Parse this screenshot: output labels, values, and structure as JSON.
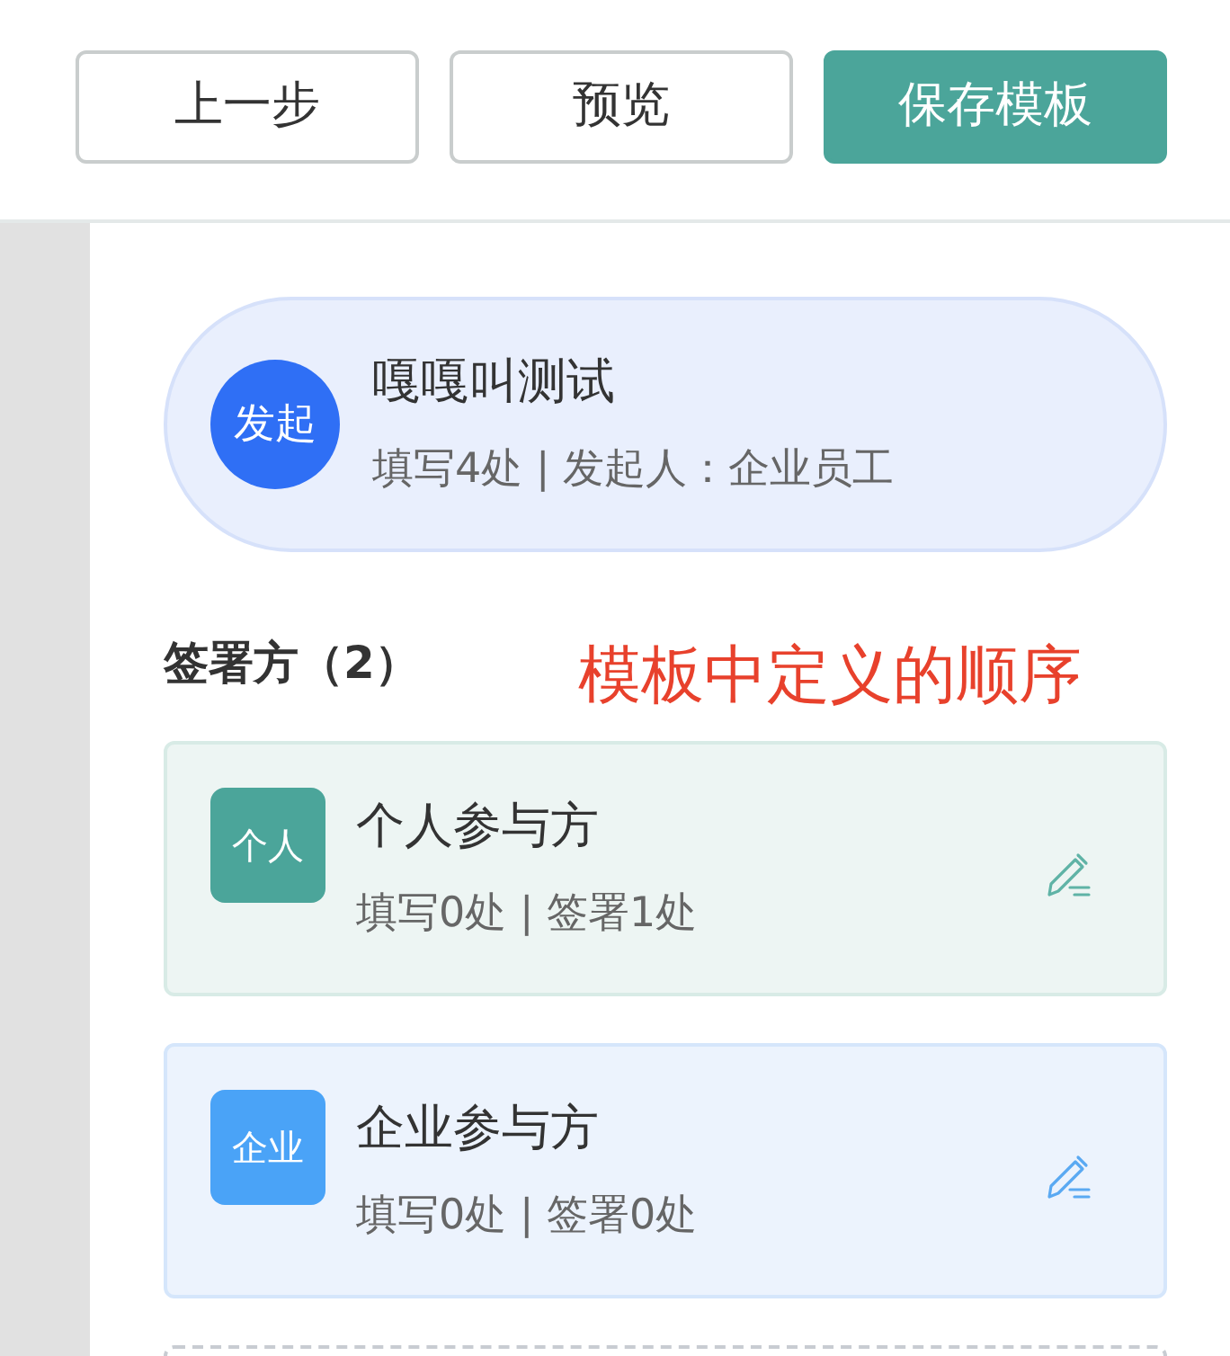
{
  "toolbar": {
    "buttons": [
      {
        "label": "上一步",
        "kind": "outline"
      },
      {
        "label": "预览",
        "kind": "outline"
      },
      {
        "label": "保存模板",
        "kind": "primary"
      }
    ]
  },
  "initiator": {
    "badge": "发起",
    "title": "嘎嘎叫测试",
    "subtitle": "填写4处 | 发起人：企业员工"
  },
  "signers": {
    "heading": "签署方（2）",
    "annotation": "模板中定义的顺序",
    "parties": [
      {
        "kind": "personal",
        "badge": "个人",
        "title": "个人参与方",
        "subtitle": "填写0处 | 签署1处"
      },
      {
        "kind": "enterprise",
        "badge": "企业",
        "title": "企业参与方",
        "subtitle": "填写0处 | 签署0处"
      }
    ]
  }
}
